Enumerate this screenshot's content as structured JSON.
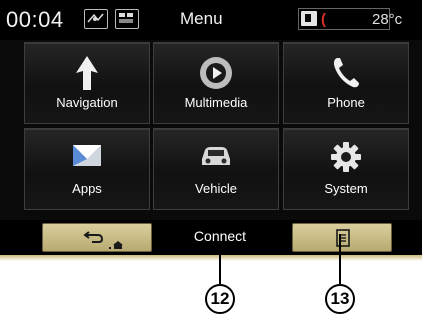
{
  "status": {
    "time": "00:04",
    "title": "Menu",
    "temperature": "28°c"
  },
  "tiles": [
    {
      "label": "Navigation",
      "icon": "navigation-arrow-icon"
    },
    {
      "label": "Multimedia",
      "icon": "play-disc-icon"
    },
    {
      "label": "Phone",
      "icon": "phone-handset-icon"
    },
    {
      "label": "Apps",
      "icon": "apps-envelope-icon"
    },
    {
      "label": "Vehicle",
      "icon": "car-icon"
    },
    {
      "label": "System",
      "icon": "gear-icon"
    }
  ],
  "bottom": {
    "connect_label": "Connect"
  },
  "callouts": [
    "12",
    "13"
  ],
  "colors": {
    "screen_bg": "#0a0a0a",
    "button_gold": "#c9bb82",
    "call_red": "#d8302b"
  }
}
